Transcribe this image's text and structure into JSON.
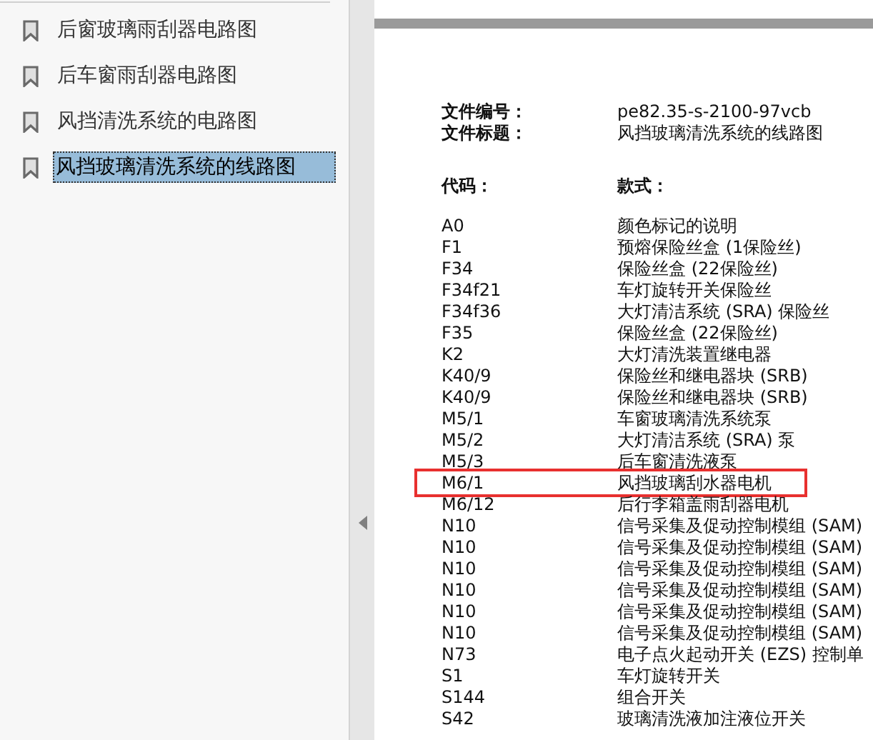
{
  "bookmarks": [
    {
      "label": "后窗玻璃雨刮器电路图",
      "selected": false
    },
    {
      "label": "后车窗雨刮器电路图",
      "selected": false
    },
    {
      "label": "风挡清洗系统的电路图",
      "selected": false
    },
    {
      "label": "风挡玻璃清洗系统的线路图",
      "selected": true
    }
  ],
  "document": {
    "header": [
      {
        "label": "文件编号：",
        "value": "pe82.35-s-2100-97vcb"
      },
      {
        "label": "文件标题：",
        "value": "风挡玻璃清洗系统的线路图"
      }
    ],
    "columns": [
      "代码：",
      "款式："
    ],
    "rows": [
      {
        "code": "A0",
        "name": "颜色标记的说明",
        "highlighted": false
      },
      {
        "code": "F1",
        "name": "预熔保险丝盒 (1保险丝)",
        "highlighted": false
      },
      {
        "code": "F34",
        "name": "保险丝盒 (22保险丝)",
        "highlighted": false
      },
      {
        "code": "F34f21",
        "name": "车灯旋转开关保险丝",
        "highlighted": false
      },
      {
        "code": "F34f36",
        "name": "大灯清洁系统 (SRA) 保险丝",
        "highlighted": false
      },
      {
        "code": "F35",
        "name": "保险丝盒 (22保险丝)",
        "highlighted": false
      },
      {
        "code": "K2",
        "name": "大灯清洗装置继电器",
        "highlighted": false
      },
      {
        "code": "K40/9",
        "name": "保险丝和继电器块 (SRB)",
        "highlighted": false
      },
      {
        "code": "K40/9",
        "name": "保险丝和继电器块 (SRB)",
        "highlighted": false
      },
      {
        "code": "M5/1",
        "name": "车窗玻璃清洗系统泵",
        "highlighted": false
      },
      {
        "code": "M5/2",
        "name": "大灯清洁系统 (SRA) 泵",
        "highlighted": false
      },
      {
        "code": "M5/3",
        "name": "后车窗清洗液泵",
        "highlighted": false
      },
      {
        "code": "M6/1",
        "name": "风挡玻璃刮水器电机",
        "highlighted": true
      },
      {
        "code": "M6/12",
        "name": "后行李箱盖雨刮器电机",
        "highlighted": false
      },
      {
        "code": "N10",
        "name": "信号采集及促动控制模组 (SAM)",
        "highlighted": false
      },
      {
        "code": "N10",
        "name": "信号采集及促动控制模组 (SAM)",
        "highlighted": false
      },
      {
        "code": "N10",
        "name": "信号采集及促动控制模组 (SAM)",
        "highlighted": false
      },
      {
        "code": "N10",
        "name": "信号采集及促动控制模组 (SAM)",
        "highlighted": false
      },
      {
        "code": "N10",
        "name": "信号采集及促动控制模组 (SAM)",
        "highlighted": false
      },
      {
        "code": "N10",
        "name": "信号采集及促动控制模组 (SAM)",
        "highlighted": false
      },
      {
        "code": "N73",
        "name": "电子点火起动开关 (EZS) 控制单",
        "highlighted": false
      },
      {
        "code": "S1",
        "name": "车灯旋转开关",
        "highlighted": false
      },
      {
        "code": "S144",
        "name": "组合开关",
        "highlighted": false
      },
      {
        "code": "S42",
        "name": "玻璃清洗液加注液位开关",
        "highlighted": false
      }
    ]
  }
}
